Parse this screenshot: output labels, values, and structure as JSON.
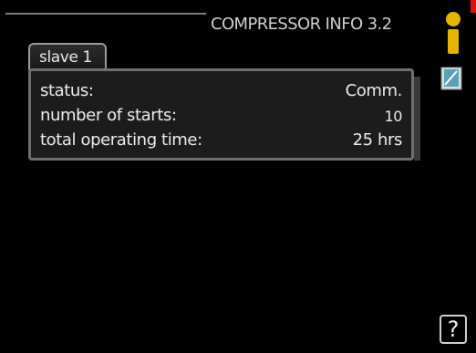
{
  "header": {
    "title": "COMPRESSOR INFO 3.2"
  },
  "tab": {
    "label": "slave 1"
  },
  "rows": [
    {
      "label": "status:",
      "value": "Comm."
    },
    {
      "label": "number of starts:",
      "value": "10"
    },
    {
      "label": "total operating time:",
      "value": "25 hrs"
    }
  ],
  "help": {
    "label": "?"
  },
  "icons": {
    "info": "info-icon",
    "manual": "book-icon",
    "help": "question-mark-icon"
  },
  "colors": {
    "background": "#000000",
    "indicator": "#e01010",
    "info_icon": "#e6b400",
    "book_icon": "#5aa0b8"
  }
}
